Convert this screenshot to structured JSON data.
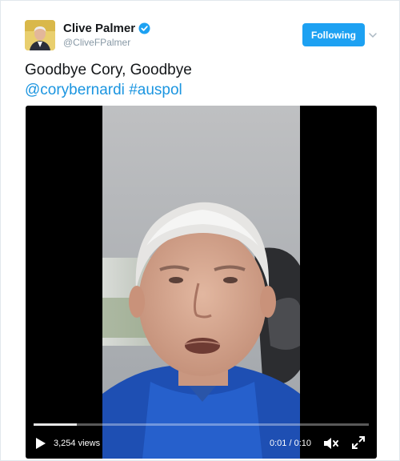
{
  "author": {
    "display_name": "Clive Palmer",
    "handle": "@CliveFPalmer",
    "verified": true
  },
  "follow_button": {
    "label": "Following"
  },
  "tweet": {
    "text_line1": "Goodbye Cory, Goodbye",
    "mention": "@corybernardi",
    "hashtag": "#auspol"
  },
  "video": {
    "views": "3,254 views",
    "current_time": "0:01",
    "separator": " / ",
    "duration": "0:10",
    "progress_fraction": 0.13
  },
  "icons": {
    "avatar": "avatar-image",
    "verified": "verified-badge-icon",
    "caret": "chevron-down-icon",
    "play": "play-icon",
    "mute": "mute-icon",
    "fullscreen": "fullscreen-icon"
  },
  "colors": {
    "accent": "#1da1f2",
    "link": "#1b95e0",
    "secondary_text": "#8899a6"
  }
}
